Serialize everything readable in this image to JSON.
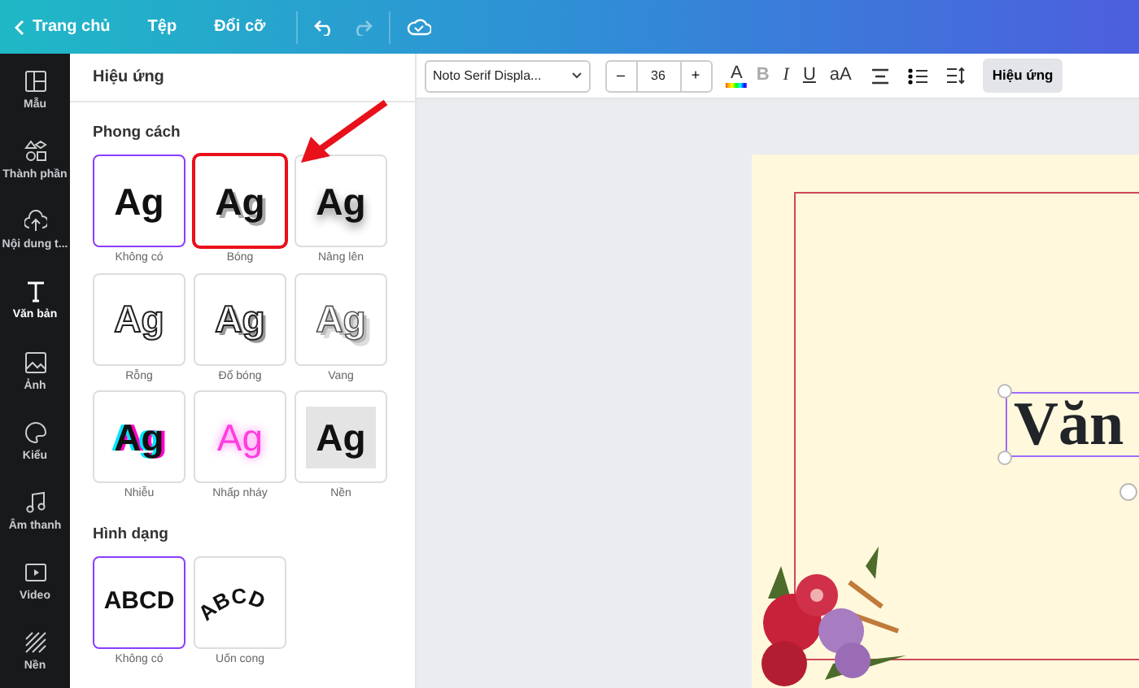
{
  "topbar": {
    "back_label": "Trang chủ",
    "menu": [
      "Tệp",
      "Đổi cỡ"
    ]
  },
  "rail": [
    {
      "label": "Mẫu",
      "kind": "layout",
      "selected": false
    },
    {
      "label": "Thành phần",
      "kind": "shapes",
      "selected": false
    },
    {
      "label": "Nội dung t...",
      "kind": "upload",
      "selected": false
    },
    {
      "label": "Văn bản",
      "kind": "text",
      "selected": true
    },
    {
      "label": "Ảnh",
      "kind": "image",
      "selected": false
    },
    {
      "label": "Kiểu",
      "kind": "palette",
      "selected": false
    },
    {
      "label": "Âm thanh",
      "kind": "music",
      "selected": false
    },
    {
      "label": "Video",
      "kind": "video",
      "selected": false
    },
    {
      "label": "Nền",
      "kind": "pattern",
      "selected": false
    }
  ],
  "panel": {
    "title": "Hiệu ứng",
    "sections": [
      {
        "title": "Phong cách",
        "tiles": [
          {
            "label": "Không có",
            "sample": "Ag",
            "kind": "none",
            "selected": true,
            "highlighted": false
          },
          {
            "label": "Bóng",
            "sample": "Ag",
            "kind": "shadow",
            "selected": false,
            "highlighted": true
          },
          {
            "label": "Nâng lên",
            "sample": "Ag",
            "kind": "lift",
            "selected": false,
            "highlighted": false
          },
          {
            "label": "Rỗng",
            "sample": "Ag",
            "kind": "hollow",
            "selected": false,
            "highlighted": false
          },
          {
            "label": "Đổ bóng",
            "sample": "Ag",
            "kind": "splice",
            "selected": false,
            "highlighted": false
          },
          {
            "label": "Vang",
            "sample": "Ag",
            "kind": "echo",
            "selected": false,
            "highlighted": false
          },
          {
            "label": "Nhiễu",
            "sample": "Ag",
            "kind": "glitch",
            "selected": false,
            "highlighted": false
          },
          {
            "label": "Nhấp nháy",
            "sample": "Ag",
            "kind": "neon",
            "selected": false,
            "highlighted": false
          },
          {
            "label": "Nền",
            "sample": "Ag",
            "kind": "background",
            "selected": false,
            "highlighted": false
          }
        ]
      },
      {
        "title": "Hình dạng",
        "tiles": [
          {
            "label": "Không có",
            "sample": "ABCD",
            "kind": "straight",
            "selected": true,
            "highlighted": false
          },
          {
            "label": "Uốn cong",
            "sample": "ABCD",
            "kind": "curve",
            "selected": false,
            "highlighted": false
          }
        ]
      }
    ]
  },
  "toolbar": {
    "font": "Noto Serif Displa...",
    "size": "36",
    "minus": "–",
    "plus": "+",
    "format": [
      {
        "kind": "color",
        "text": "A",
        "disabled": false
      },
      {
        "kind": "bold",
        "text": "B",
        "disabled": true
      },
      {
        "kind": "italic",
        "text": "I",
        "disabled": false
      },
      {
        "kind": "underline",
        "text": "U",
        "disabled": false
      },
      {
        "kind": "case",
        "text": "aA",
        "disabled": false
      }
    ],
    "effects_button": {
      "label": "Hiệu ứng",
      "active": true
    }
  },
  "canvas": {
    "text": "Văn"
  }
}
